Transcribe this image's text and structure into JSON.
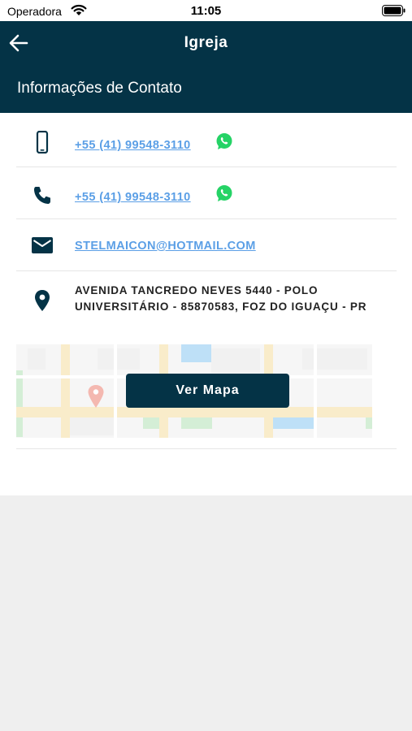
{
  "status_bar": {
    "carrier": "Operadora",
    "time": "11:05"
  },
  "header": {
    "title": "Igreja",
    "section_title": "Informações de Contato",
    "color": "#043346"
  },
  "contacts": {
    "mobile": "+55 (41) 99548-3110 ",
    "phone": "+55 (41) 99548-3110 ",
    "email": "STELMAICON@HOTMAIL.COM",
    "address": "AVENIDA TANCREDO NEVES 5440 - POLO UNIVERSITÁRIO - 85870583, FOZ DO IGUAÇU - PR"
  },
  "map": {
    "button_label": "Ver Mapa"
  },
  "icons": {
    "back": "arrow-left-icon",
    "mobile": "smartphone-icon",
    "phone": "phone-icon",
    "whatsapp": "whatsapp-icon",
    "email": "mail-icon",
    "location": "location-pin-icon"
  },
  "colors": {
    "primary": "#043346",
    "link": "#5b9fe6",
    "whatsapp": "#25d366"
  }
}
